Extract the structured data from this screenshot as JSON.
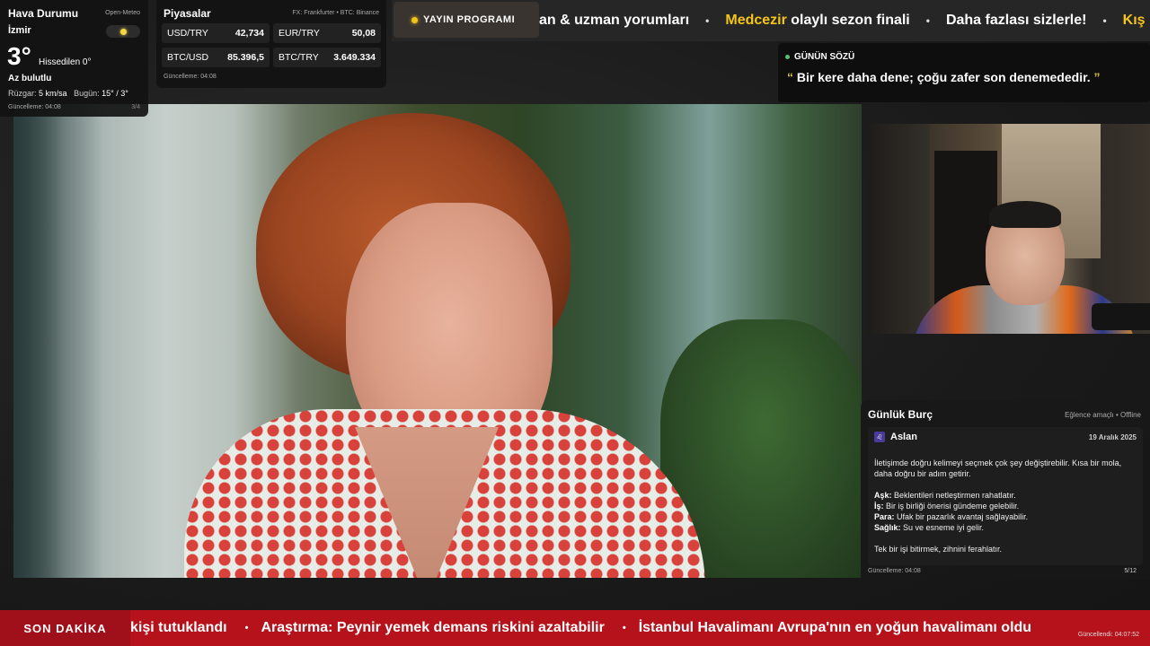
{
  "weather": {
    "title": "Hava Durumu",
    "source": "Open-Meteo",
    "city": "İzmir",
    "icon": "sun-icon",
    "temp": "3°",
    "feels_like": "Hissedilen 0°",
    "condition": "Az bulutlu",
    "wind_label": "Rüzgar:",
    "wind_value": "5 km/sa",
    "today_label": "Bugün:",
    "today_value": "15° / 3°",
    "updated": "Güncelleme: 04:08",
    "page": "3/4"
  },
  "markets": {
    "title": "Piyasalar",
    "source": "FX: Frankfurter • BTC: Binance",
    "items": [
      {
        "pair": "USD/TRY",
        "value": "42,734"
      },
      {
        "pair": "EUR/TRY",
        "value": "50,08"
      },
      {
        "pair": "BTC/USD",
        "value": "85.396,5"
      },
      {
        "pair": "BTC/TRY",
        "value": "3.649.334"
      }
    ],
    "updated": "Güncelleme: 04:08"
  },
  "top_ticker": {
    "schedule_label": "YAYIN PROGRAMI",
    "items": [
      {
        "accent": "",
        "text": "an & uzman yorumları"
      },
      {
        "accent": "Medcezir",
        "text": " olaylı sezon finali"
      },
      {
        "accent": "",
        "text": "Daha fazlası sizlerle!"
      },
      {
        "accent": "Kış",
        "text": ""
      }
    ],
    "separator": "•"
  },
  "quote": {
    "title": "GÜNÜN SÖZÜ",
    "open_mark": "“",
    "text": "Bir kere daha dene; çoğu zafer son denemededir.",
    "close_mark": "”"
  },
  "horoscope": {
    "title": "Günlük Burç",
    "tag": "Eğlence amaçlı • Offline",
    "sign_icon": "leo-icon",
    "sign_symbol": "♌",
    "sign": "Aslan",
    "date": "19 Aralık 2025",
    "intro": "İletişimde doğru kelimeyi seçmek çok şey değiştirebilir. Kısa bir mola, daha doğru bir adım getirir.",
    "lines": [
      {
        "label": "Aşk:",
        "text": " Beklentileri netleştirmen rahatlatır."
      },
      {
        "label": "İş:",
        "text": " Bir iş birliği önerisi gündeme gelebilir."
      },
      {
        "label": "Para:",
        "text": " Ufak bir pazarlık avantaj sağlayabilir."
      },
      {
        "label": "Sağlık:",
        "text": " Su ve esneme iyi gelir."
      }
    ],
    "outro": "Tek bir işi bitirmek, zihnini ferahlatır.",
    "updated": "Güncelleme: 04:08",
    "page": "5/12"
  },
  "breaking": {
    "label": "SON DAKİKA",
    "separator": "•",
    "items": [
      "kişi tutuklandı",
      "Araştırma: Peynir yemek demans riskini azaltabilir",
      "İstanbul Havalimanı Avrupa'nın en yoğun havalimanı oldu"
    ],
    "updated": "Güncellendi: 04:07:52"
  }
}
